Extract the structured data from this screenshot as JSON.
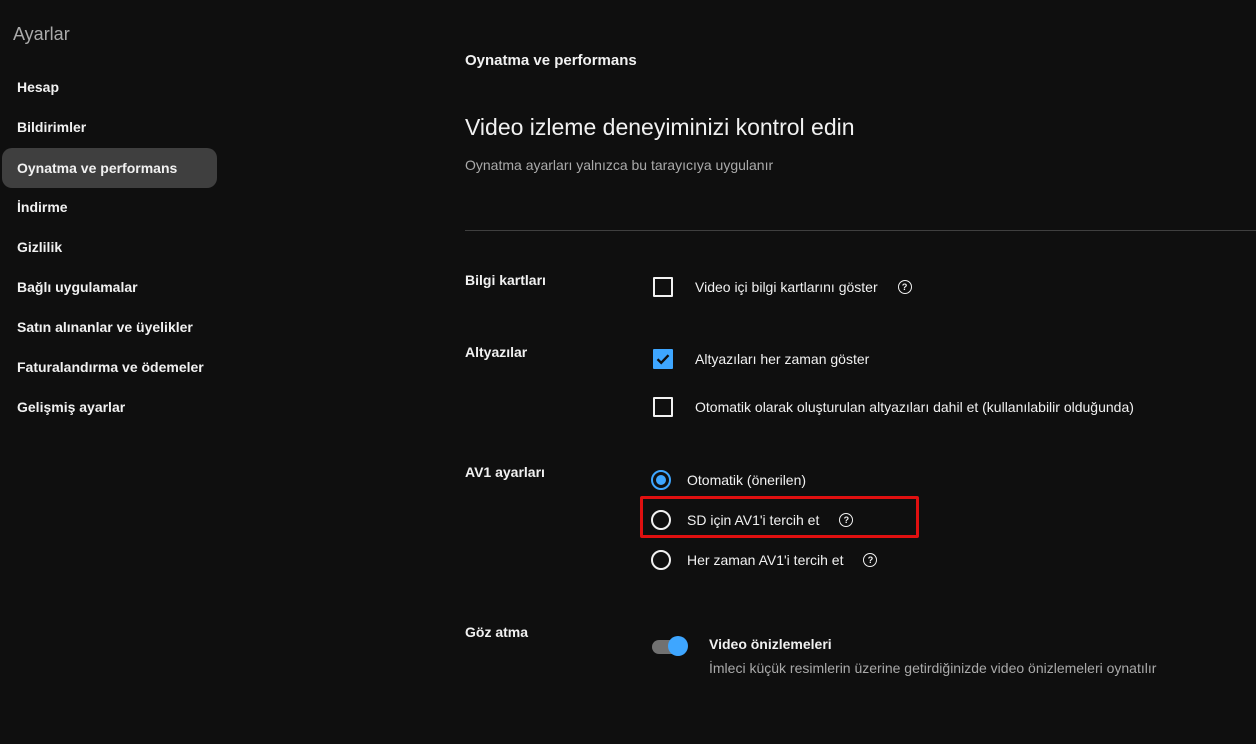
{
  "sidebar": {
    "title": "Ayarlar",
    "items": [
      {
        "label": "Hesap"
      },
      {
        "label": "Bildirimler"
      },
      {
        "label": "Oynatma ve performans",
        "active": true
      },
      {
        "label": "İndirme"
      },
      {
        "label": "Gizlilik"
      },
      {
        "label": "Bağlı uygulamalar"
      },
      {
        "label": "Satın alınanlar ve üyelikler"
      },
      {
        "label": "Faturalandırma ve ödemeler"
      },
      {
        "label": "Gelişmiş ayarlar"
      }
    ]
  },
  "main": {
    "section_heading": "Oynatma ve performans",
    "title": "Video izleme deneyiminizi kontrol edin",
    "subtitle": "Oynatma ayarları yalnızca bu tarayıcıya uygulanır",
    "info_cards": {
      "label": "Bilgi kartları",
      "option": {
        "label": "Video içi bilgi kartlarını göster",
        "checked": false
      }
    },
    "captions": {
      "label": "Altyazılar",
      "options": [
        {
          "label": "Altyazıları her zaman göster",
          "checked": true
        },
        {
          "label": "Otomatik olarak oluşturulan altyazıları dahil et (kullanılabilir olduğunda)",
          "checked": false
        }
      ]
    },
    "av1": {
      "label": "AV1 ayarları",
      "options": [
        {
          "label": "Otomatik (önerilen)",
          "selected": true
        },
        {
          "label": "SD için AV1'i tercih et",
          "selected": false
        },
        {
          "label": "Her zaman AV1'i tercih et",
          "selected": false
        }
      ]
    },
    "peek": {
      "label": "Göz atma",
      "toggle_title": "Video önizlemeleri",
      "toggle_desc": "İmleci küçük resimlerin üzerine getirdiğinizde video önizlemeleri oynatılır",
      "enabled": true
    },
    "help_glyph": "?"
  },
  "colors": {
    "background": "#0f0f0f",
    "accent": "#3ea6ff",
    "highlight": "#e01010"
  }
}
